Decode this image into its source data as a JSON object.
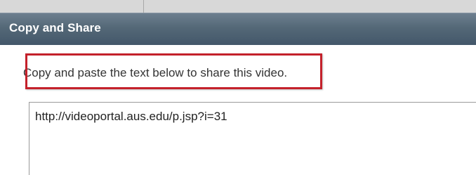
{
  "dialog": {
    "title": "Copy and Share",
    "instructions": "Copy and paste the text below to share this video.",
    "share_url": "http://videoportal.aus.edu/p.jsp?i=31"
  },
  "colors": {
    "titlebar": "#546877",
    "highlight": "#c4212b"
  }
}
